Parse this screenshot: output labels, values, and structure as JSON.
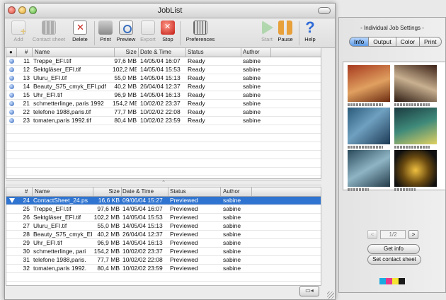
{
  "window": {
    "title": "JobList",
    "toolbar": [
      {
        "label": "Add",
        "icon": "add-icon",
        "enabled": false
      },
      {
        "label": "Contact sheet",
        "icon": "contact-sheet-icon",
        "enabled": false
      },
      {
        "label": "Delete",
        "icon": "delete-icon",
        "enabled": true
      },
      {
        "label": "Print",
        "icon": "printer-icon",
        "enabled": true
      },
      {
        "label": "Preview",
        "icon": "preview-icon",
        "enabled": true
      },
      {
        "label": "Export",
        "icon": "export-icon",
        "enabled": false
      },
      {
        "label": "Stop",
        "icon": "stop-icon",
        "enabled": true
      },
      {
        "label": "Preferences",
        "icon": "preferences-icon",
        "enabled": true
      },
      {
        "label": "Start",
        "icon": "start-icon",
        "enabled": false
      },
      {
        "label": "Pause",
        "icon": "pause-icon",
        "enabled": true
      },
      {
        "label": "Help",
        "icon": "help-icon",
        "enabled": true
      }
    ]
  },
  "upper_table": {
    "headers": [
      "#",
      "Name",
      "Size",
      "Date & Time",
      "Status",
      "Author"
    ],
    "rows": [
      {
        "num": "11",
        "name": "Treppe_EFI.tif",
        "size": "97,6 MB",
        "date": "14/05/04 16:07",
        "status": "Ready",
        "author": "sabine"
      },
      {
        "num": "12",
        "name": "Sektgläser_EFI.tif",
        "size": "102,2 MB",
        "date": "14/05/04 15:53",
        "status": "Ready",
        "author": "sabine"
      },
      {
        "num": "13",
        "name": "Uluru_EFI.tif",
        "size": "55,0 MB",
        "date": "14/05/04 15:13",
        "status": "Ready",
        "author": "sabine"
      },
      {
        "num": "14",
        "name": "Beauty_S75_cmyk_EFI.pdf",
        "size": "40,2 MB",
        "date": "26/04/04 12:37",
        "status": "Ready",
        "author": "sabine"
      },
      {
        "num": "15",
        "name": "Uhr_EFI.tif",
        "size": "96,9 MB",
        "date": "14/05/04 16:13",
        "status": "Ready",
        "author": "sabine"
      },
      {
        "num": "21",
        "name": "schmetterlinge, paris 1992",
        "size": "154,2 MB",
        "date": "10/02/02 23:37",
        "status": "Ready",
        "author": "sabine"
      },
      {
        "num": "22",
        "name": "telefone 1988,paris.tif",
        "size": "77,7 MB",
        "date": "10/02/02 22:08",
        "status": "Ready",
        "author": "sabine"
      },
      {
        "num": "23",
        "name": "tomaten,paris 1992.tif",
        "size": "80,4 MB",
        "date": "10/02/02 23:59",
        "status": "Ready",
        "author": "sabine"
      }
    ]
  },
  "lower_table": {
    "headers": [
      "#",
      "Name",
      "Size",
      "Date & Time",
      "Status",
      "Author"
    ],
    "rows": [
      {
        "num": "24",
        "name": "ContactSheet_24.ps",
        "size": "16,6 KB",
        "date": "09/06/04 15:27",
        "status": "Previewed",
        "author": "sabine",
        "selected": true
      },
      {
        "num": "25",
        "name": "Treppe_EFI.tif",
        "size": "97,6 MB",
        "date": "14/05/04 16:07",
        "status": "Previewed",
        "author": "sabine"
      },
      {
        "num": "26",
        "name": "Sektgläser_EFI.tif",
        "size": "102,2 MB",
        "date": "14/05/04 15:53",
        "status": "Previewed",
        "author": "sabine"
      },
      {
        "num": "27",
        "name": "Uluru_EFI.tif",
        "size": "55,0 MB",
        "date": "14/05/04 15:13",
        "status": "Previewed",
        "author": "sabine"
      },
      {
        "num": "28",
        "name": "Beauty_S75_cmyk_EI",
        "size": "40,2 MB",
        "date": "26/04/04 12:37",
        "status": "Previewed",
        "author": "sabine"
      },
      {
        "num": "29",
        "name": "Uhr_EFI.tif",
        "size": "96,9 MB",
        "date": "14/05/04 16:13",
        "status": "Previewed",
        "author": "sabine"
      },
      {
        "num": "30",
        "name": "schmetterlinge, pari",
        "size": "154,2 MB",
        "date": "10/02/02 23:37",
        "status": "Previewed",
        "author": "sabine"
      },
      {
        "num": "31",
        "name": "telefone 1988,paris.",
        "size": "77,7 MB",
        "date": "10/02/02 22:08",
        "status": "Previewed",
        "author": "sabine"
      },
      {
        "num": "32",
        "name": "tomaten,paris 1992.",
        "size": "80,4 MB",
        "date": "10/02/02 23:59",
        "status": "Previewed",
        "author": "sabine"
      }
    ]
  },
  "drawer": {
    "title": "- Individual Job Settings -",
    "tabs": [
      {
        "label": "Info",
        "active": true
      },
      {
        "label": "Output",
        "active": false
      },
      {
        "label": "Color",
        "active": false
      },
      {
        "label": "Print",
        "active": false
      }
    ],
    "pager": {
      "prev": "<",
      "page": "1/2",
      "next": ">"
    },
    "get_info": "Get info",
    "set_contact_sheet": "Set contact sheet",
    "swatch_colors": [
      "#19a9e0",
      "#e6378a",
      "#f5e532",
      "#1a1a1a"
    ]
  },
  "colors": {
    "selection": "#2f74d0",
    "status_dot": "#2c5fb8"
  }
}
